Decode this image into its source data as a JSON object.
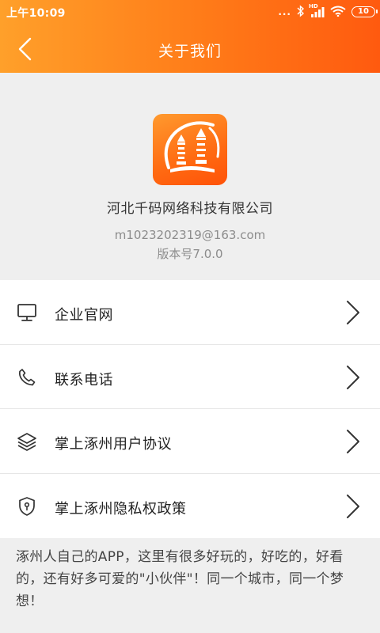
{
  "status_bar": {
    "time": "上午10:09",
    "signal_dots": "...",
    "network_label": "HD",
    "battery_level": "10"
  },
  "nav": {
    "title": "关于我们"
  },
  "about": {
    "company_name": "河北千码网络科技有限公司",
    "email": "m1023202319@163.com",
    "version": "版本号7.0.0"
  },
  "menu": {
    "items": [
      {
        "label": "企业官网",
        "icon": "monitor-icon"
      },
      {
        "label": "联系电话",
        "icon": "phone-icon"
      },
      {
        "label": "掌上涿州用户协议",
        "icon": "layers-icon"
      },
      {
        "label": "掌上涿州隐私权政策",
        "icon": "shield-icon"
      }
    ]
  },
  "intro_text": "涿州人自己的APP，这里有很多好玩的，好吃的，好看的，还有好多可爱的\"小伙伴\"！同一个城市，同一个梦想！",
  "colors": {
    "header_gradient_start": "#ffa02a",
    "header_gradient_end": "#ff5a0f",
    "background": "#efefef"
  }
}
